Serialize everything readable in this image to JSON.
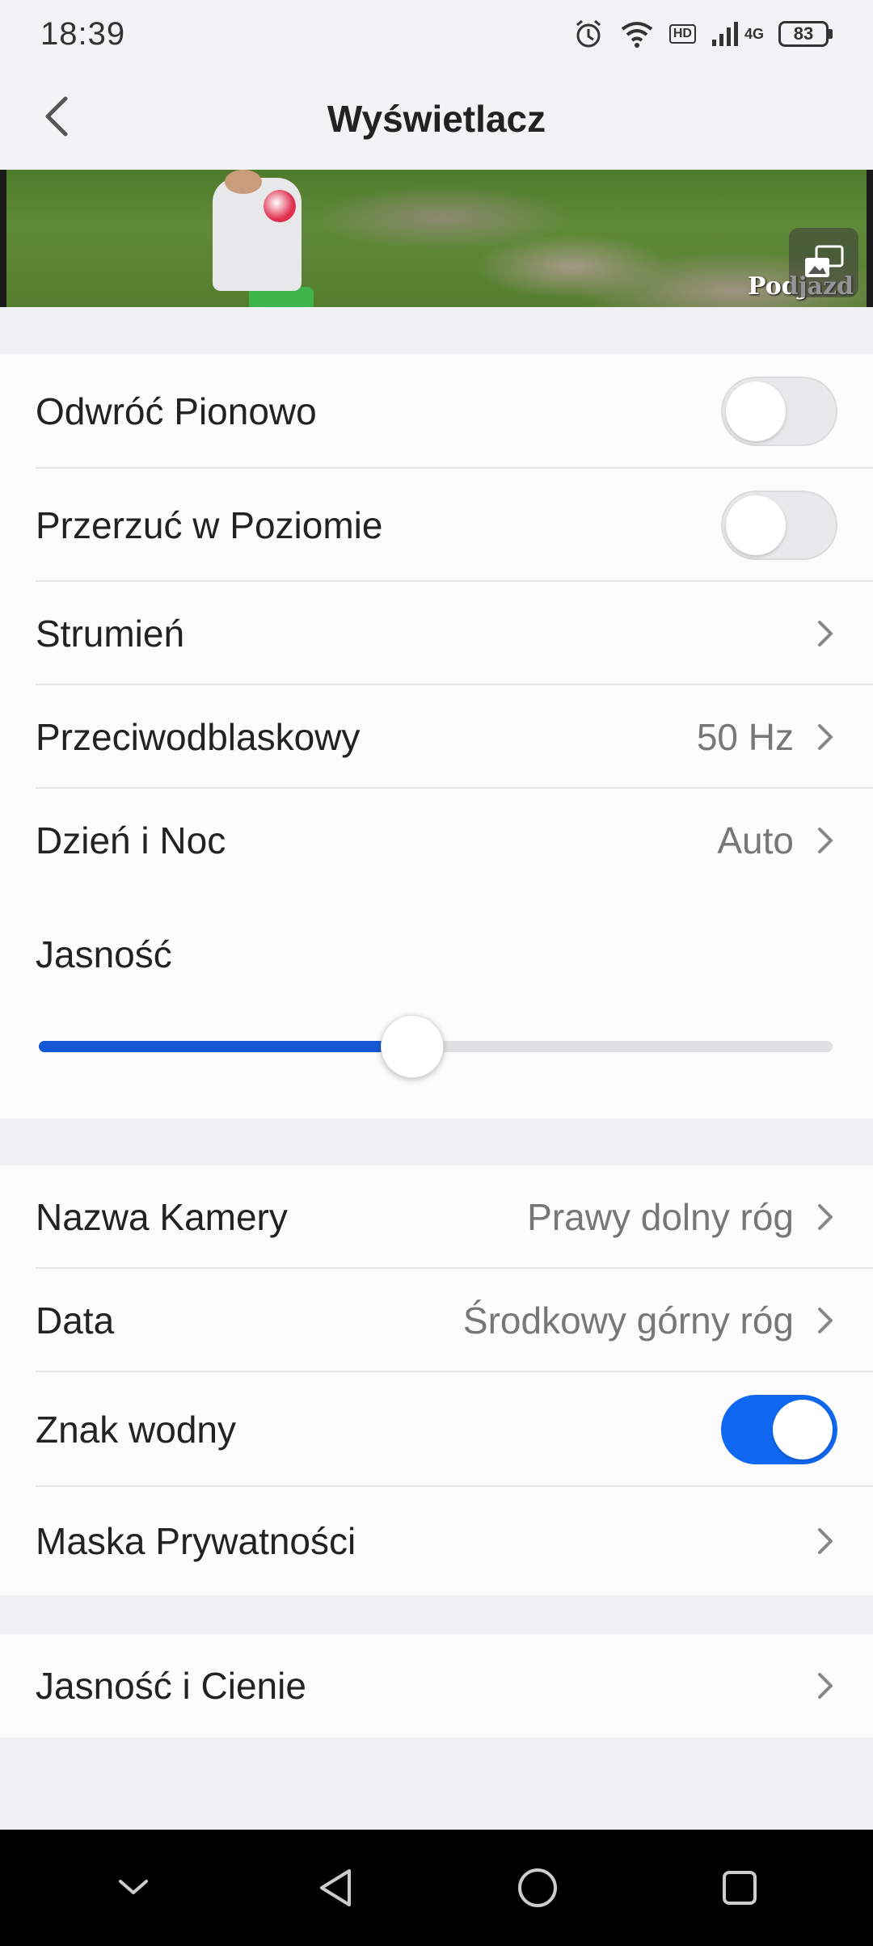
{
  "status_bar": {
    "time": "18:39",
    "network": "4G",
    "hd_badge": "HD",
    "battery": "83",
    "icons": [
      "alarm-icon",
      "wifi-icon",
      "hd-icon",
      "signal-icon",
      "battery-icon"
    ]
  },
  "header": {
    "title": "Wyświetlacz",
    "back_icon": "chevron-left-icon"
  },
  "preview": {
    "overlay_text": "Podjazd",
    "pip_icon": "picture-in-picture-icon"
  },
  "group1": {
    "flip_vertical": {
      "label": "Odwróć Pionowo",
      "enabled": false
    },
    "flip_horizontal": {
      "label": "Przerzuć w Poziomie",
      "enabled": false
    },
    "stream": {
      "label": "Strumień",
      "value": ""
    },
    "anti_flicker": {
      "label": "Przeciwodblaskowy",
      "value": "50 Hz"
    },
    "day_night": {
      "label": "Dzień i Noc",
      "value": "Auto"
    },
    "brightness": {
      "label": "Jasność",
      "level": 0.47
    }
  },
  "group2": {
    "camera_name": {
      "label": "Nazwa Kamery",
      "value": "Prawy dolny róg"
    },
    "date": {
      "label": "Data",
      "value": "Środkowy górny róg"
    },
    "watermark": {
      "label": "Znak wodny",
      "enabled": true
    },
    "privacy_mask": {
      "label": "Maska Prywatności"
    }
  },
  "group3": {
    "brightness_shadows": {
      "label": "Jasność i Cienie"
    }
  },
  "colors": {
    "accent": "#1068f2",
    "slider_fill": "#1558d6",
    "background": "#f0f1f3",
    "card": "#fcfcfc"
  },
  "nav_bar": {
    "icons": [
      "collapse-icon",
      "back-triangle-icon",
      "home-circle-icon",
      "recents-square-icon"
    ]
  }
}
